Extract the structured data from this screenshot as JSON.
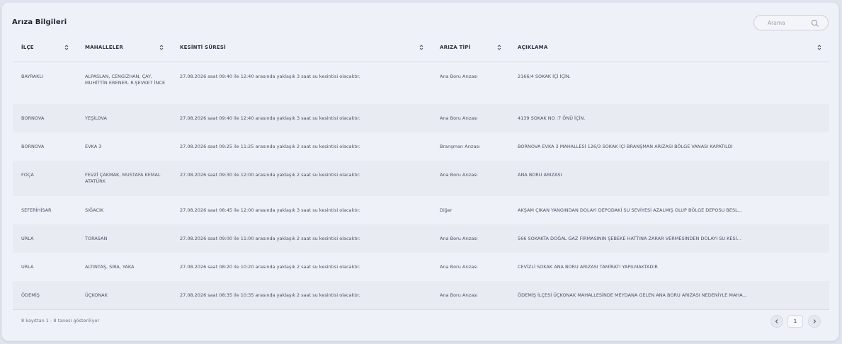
{
  "header": {
    "title": "Arıza Bilgileri"
  },
  "search": {
    "placeholder": "Arama"
  },
  "table": {
    "columns": [
      "İLÇE",
      "MAHALLELER",
      "KESİNTİ SÜRESİ",
      "ARIZA TİPİ",
      "AÇIKLAMA"
    ],
    "rows": [
      {
        "ilce": "BAYRAKLI",
        "mahalleler": "ALPASLAN, CENGİZHAN, ÇAY, MUHİTTİN ERENER, R.ŞEVKET İNCE",
        "sure": "27.08.2026 saat 09:40 ile 12:40 arasında yaklaşık 3 saat su kesintisi olacaktır.",
        "tip": "Ana Boru Arızası",
        "aciklama": "2166/4 SOKAK İÇİ İÇİN."
      },
      {
        "ilce": "BORNOVA",
        "mahalleler": "YEŞİLOVA",
        "sure": "27.08.2026 saat 09:40 ile 12:40 arasında yaklaşık 3 saat su kesintisi olacaktır.",
        "tip": "Ana Boru Arızası",
        "aciklama": "4139 SOKAK NO :7 ÖNÜ İÇİN."
      },
      {
        "ilce": "BORNOVA",
        "mahalleler": "EVKA 3",
        "sure": "27.08.2026 saat 09:25 ile 11:25 arasında yaklaşık 2 saat su kesintisi olacaktır.",
        "tip": "Branşman Arızası",
        "aciklama": "BORNOVA EVKA 3 MAHALLESİ 126/3 SOKAK İÇİ BRANŞMAN ARIZASI BÖLGE VANASI KAPATILDI"
      },
      {
        "ilce": "FOÇA",
        "mahalleler": "FEVZİ ÇAKMAK, MUSTAFA KEMAL ATATÜRK",
        "sure": "27.08.2026 saat 09:30 ile 12:00 arasında yaklaşık 2 saat su kesintisi olacaktır.",
        "tip": "Ana Boru Arızası",
        "aciklama": "ANA BORU ARIZASI"
      },
      {
        "ilce": "SEFERİHİSAR",
        "mahalleler": "SIĞACIK",
        "sure": "27.08.2026 saat 08:45 ile 12:00 arasında yaklaşık 3 saat su kesintisi olacaktır.",
        "tip": "Diğer",
        "aciklama": "AKŞAM ÇIKAN YANGINDAN DOLAYI DEPODAKİ SU SEVİYESİ AZALMIŞ OLUP BÖLGE DEPOSU BESL..."
      },
      {
        "ilce": "URLA",
        "mahalleler": "TORASAN",
        "sure": "27.08.2026 saat 09:00 ile 11:00 arasında yaklaşık 2 saat su kesintisi olacaktır.",
        "tip": "Ana Boru Arızası",
        "aciklama": "566 SOKAKTA DOĞAL GAZ FİRMASININ ŞEBEKE HATTINA ZARAR VERMESİNDEN DOLAYI SU KESİ..."
      },
      {
        "ilce": "URLA",
        "mahalleler": "ALTINTAŞ, SIRA, YAKA",
        "sure": "27.08.2026 saat 08:20 ile 10:20 arasında yaklaşık 2 saat su kesintisi olacaktır.",
        "tip": "Ana Boru Arızası",
        "aciklama": "CEVİZLİ SOKAK ANA BORU ARIZASI TAMİRATI YAPILMAKTADIR"
      },
      {
        "ilce": "ÖDEMİŞ",
        "mahalleler": "ÜÇKONAK",
        "sure": "27.08.2026 saat 08:35 ile 10:35 arasında yaklaşık 2 saat su kesintisi olacaktır.",
        "tip": "Ana Boru Arızası",
        "aciklama": "ÖDEMİŞ İLÇESİ ÜÇKONAK MAHALLESİNDE MEYDANA GELEN ANA BORU ARIZASI NEDENİYLE MAHA..."
      }
    ]
  },
  "footer": {
    "summary": "8 kayıttan 1 - 8 tanesi gösteriliyor",
    "page": "1"
  }
}
